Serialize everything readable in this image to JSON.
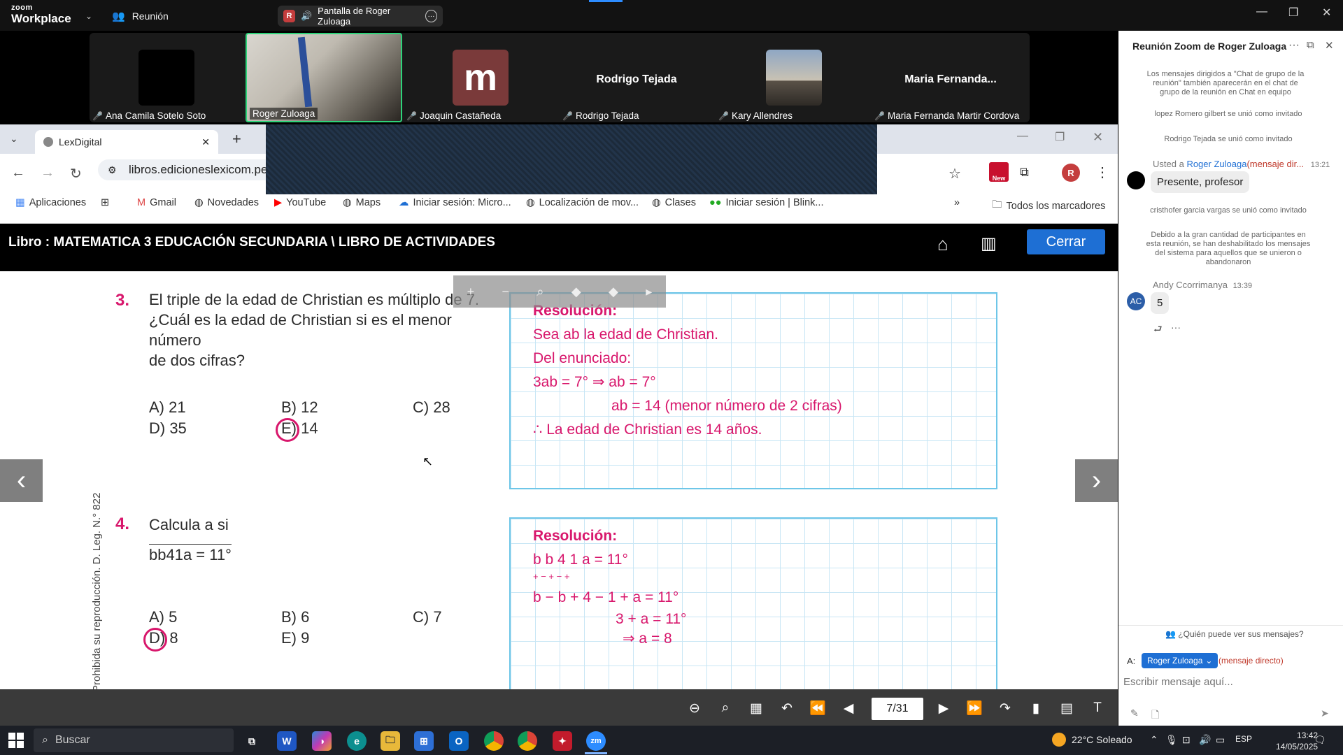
{
  "zoom": {
    "logo_top": "zoom",
    "logo_bottom": "Workplace",
    "meeting_label": "Reunión",
    "share_badge": "R",
    "share_title": "Pantalla de Roger Zuloaga"
  },
  "participants": [
    {
      "name": "Ana Camila Sotelo Soto",
      "muted": true
    },
    {
      "name": "Roger Zuloaga",
      "muted": false
    },
    {
      "name": "Joaquin Castañeda",
      "muted": true,
      "avatar_letter": "m"
    },
    {
      "name": "Rodrigo Tejada",
      "muted": true,
      "display": "Rodrigo Tejada"
    },
    {
      "name": "Kary Allendres",
      "muted": true
    },
    {
      "name": "Maria Fernanda Martir Cordova",
      "muted": true,
      "display": "Maria  Fernanda..."
    }
  ],
  "browser": {
    "tab_title": "LexDigital",
    "url": "libros.edicioneslexicom.pe/",
    "profile_initial": "R",
    "bookmarks": [
      "Aplicaciones",
      "Gmail",
      "Novedades",
      "YouTube",
      "Maps",
      "Iniciar sesión: Micro...",
      "Localización de mov...",
      "Clases",
      "Iniciar sesión | Blink..."
    ],
    "all_bookmarks": "Todos los marcadores"
  },
  "book": {
    "title": "Libro : MATEMATICA 3 EDUCACIÓN SECUNDARIA \\ LIBRO DE ACTIVIDADES",
    "close_label": "Cerrar",
    "side_text": "Prohibida su reproducción. D. Leg. N.° 822",
    "q3": {
      "num": "3.",
      "lines": [
        "El triple de la edad de Christian es múltiplo de 7.",
        "¿Cuál es la edad de Christian si es el menor número",
        "de dos cifras?"
      ],
      "options": [
        "A) 21",
        "B) 12",
        "C) 28",
        "D) 35",
        "E) 14"
      ],
      "res_title": "Resolución:",
      "res_lines": [
        "Sea ab la edad de Christian.",
        "Del enunciado:",
        "3ab = 7° ⇒ ab = 7°",
        "ab = 14 (menor número de 2 cifras)",
        "∴ La edad de Christian es 14 años."
      ]
    },
    "q4": {
      "num": "4.",
      "line1": "Calcula a si",
      "line2": "bb41a = 11°",
      "options": [
        "A) 5",
        "B) 6",
        "C) 7",
        "D) 8",
        "E) 9"
      ],
      "res_title": "Resolución:",
      "res_lines": [
        "b b 4 1 a = 11°",
        "+ − + − +",
        "b − b + 4 − 1 + a = 11°",
        "3 + a = 11°",
        "⇒ a = 8"
      ]
    },
    "page_indicator": "7/31"
  },
  "chat": {
    "title": "Reunión Zoom de Roger Zuloaga",
    "notice": "Los mensajes dirigidos a \"Chat de grupo de la reunión\" también aparecerán en el chat de grupo de la reunión en Chat en equipo",
    "sys1": "lopez Romero gilbert se unió como invitado",
    "sys2": "Rodrigo Tejada se unió como invitado",
    "msg1_prefix": "Usted a",
    "msg1_to": "Roger Zuloaga",
    "msg1_suffix": "(mensaje dir...",
    "msg1_time": "13:21",
    "msg1_text": "Presente, profesor",
    "sys3": "cristhofer garcia vargas se unió como invitado",
    "sys4": "Debido a la gran cantidad de participantes en esta reunión, se han deshabilitado los mensajes del sistema para aquellos que se unieron o abandonaron",
    "msg2_name": "Andy Ccorrimanya",
    "msg2_time": "13:39",
    "msg2_avatar": "AC",
    "msg2_text": "5",
    "who_sees": "¿Quién puede ver sus mensajes?",
    "to_label": "A:",
    "recipient": "Roger Zuloaga",
    "direct": "(mensaje directo)",
    "placeholder": "Escribir mensaje aquí..."
  },
  "taskbar": {
    "search": "Buscar",
    "weather": "22°C  Soleado",
    "lang": "ESP",
    "time": "13:42",
    "date": "14/05/2025"
  }
}
